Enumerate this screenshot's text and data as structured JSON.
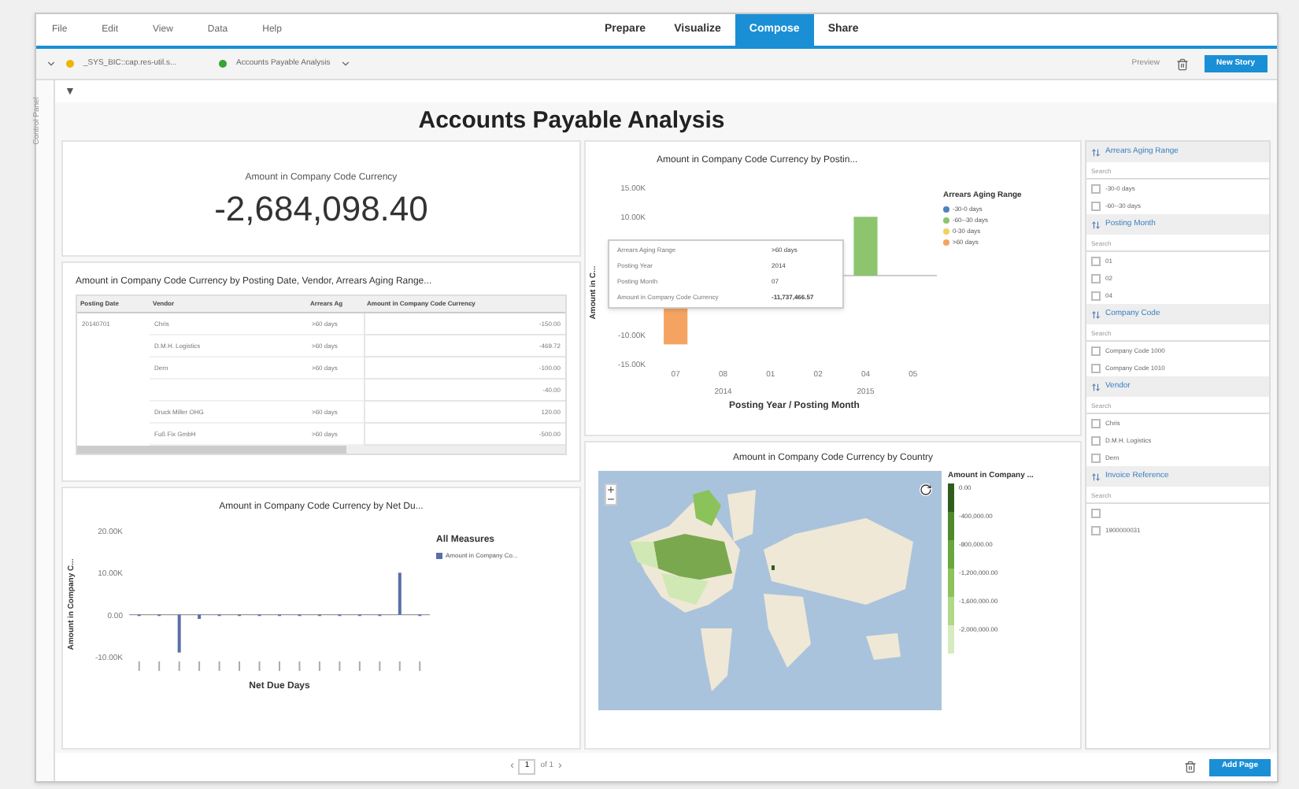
{
  "menu": [
    "File",
    "Edit",
    "View",
    "Data",
    "Help"
  ],
  "mode_tabs": [
    {
      "label": "Prepare",
      "selected": false
    },
    {
      "label": "Visualize",
      "selected": false
    },
    {
      "label": "Compose",
      "selected": true
    },
    {
      "label": "Share",
      "selected": false
    }
  ],
  "toolbar": {
    "source": "_SYS_BIC::cap.res-util.s...",
    "story": "Accounts Payable Analysis",
    "preview": "Preview",
    "new_story": "New Story"
  },
  "control_panel": {
    "label": "Control Panel",
    "filter_toggle": "▼"
  },
  "page_title": "Accounts Payable Analysis",
  "kpi": {
    "title": "Amount in Company Code Currency",
    "value": "-2,684,098.40"
  },
  "table": {
    "title": "Amount in Company Code Currency by Posting Date, Vendor, Arrears Aging Range...",
    "columns": [
      "Posting Date",
      "Vendor",
      "Arrears Ag",
      "Amount in Company Code Currency"
    ],
    "rows": [
      [
        "20140701",
        "Chris",
        ">60 days",
        "-150.00"
      ],
      [
        "",
        "D.M.H. Logistics",
        ">60 days",
        "-469.72"
      ],
      [
        "",
        "Dern",
        ">60 days",
        "-100.00"
      ],
      [
        "",
        "",
        "",
        "-40.00"
      ],
      [
        "",
        "Druck Miller OHG",
        ">60 days",
        "120.00"
      ],
      [
        "",
        "Fuß Fix GmbH",
        ">60 days",
        "-500.00"
      ]
    ]
  },
  "posting_chart": {
    "chart_data": {
      "type": "bar",
      "title": "Amount in Company Code Currency by Postin...",
      "xlabel": "Posting Year / Posting Month",
      "ylabel": "Amount in C...",
      "categories": [
        "07",
        "08",
        "01",
        "02",
        "04",
        "05"
      ],
      "series": [
        {
          "name": "-30-0 days",
          "color": "#4f81bd",
          "values": [
            null,
            null,
            null,
            null,
            null,
            null
          ]
        },
        {
          "name": "-60--30 days",
          "color": "#8cc56d",
          "values": [
            null,
            null,
            null,
            null,
            10000,
            null
          ]
        },
        {
          "name": "0-30 days",
          "color": "#f2d25c",
          "values": [
            null,
            null,
            null,
            null,
            null,
            null
          ]
        },
        {
          "name": ">60 days",
          "color": "#f4a460",
          "values": [
            -11700,
            null,
            null,
            null,
            null,
            null
          ]
        }
      ],
      "ylim": [
        -15000,
        15000
      ],
      "yticks": [
        {
          "value": 15000,
          "label": "15.00K"
        },
        {
          "value": 10000,
          "label": "10.00K"
        },
        {
          "value": -10000,
          "label": "-10.00K"
        },
        {
          "value": -15000,
          "label": "-15.00K"
        }
      ]
    },
    "year_groups": [
      "2014",
      "2015"
    ],
    "legend_title": "Arrears Aging Range",
    "tooltip": [
      {
        "label": "Arrears Aging Range",
        "value": ">60 days"
      },
      {
        "label": "Posting Year",
        "value": "2014"
      },
      {
        "label": "Posting Month",
        "value": "07"
      },
      {
        "label": "Amount in Company Code Currency",
        "value": "-11,737,466.57"
      }
    ]
  },
  "net_due_chart": {
    "chart_data": {
      "type": "bar",
      "title": "Amount in Company Code Currency by Net Du...",
      "xlabel": "Net Due Days",
      "ylabel": "Amount in Company C...",
      "series": [
        {
          "name": "Amount in Company Co...",
          "color": "#5b6fa8",
          "values": [
            -300,
            -300,
            -9000,
            -1000,
            -200,
            -200,
            -300,
            -200,
            -200,
            -200,
            -200,
            -200,
            -200,
            10000,
            0
          ]
        }
      ],
      "ylim": [
        -10000,
        20000
      ],
      "yticks": [
        {
          "value": 20000,
          "label": "20.00K"
        },
        {
          "value": 10000,
          "label": "10.00K"
        },
        {
          "value": 0,
          "label": "0.00"
        },
        {
          "value": -10000,
          "label": "-10.00K"
        }
      ]
    },
    "legend_title": "All Measures"
  },
  "map": {
    "title": "Amount in Company Code Currency by Country",
    "legend_title": "Amount in Company ...",
    "legend": [
      {
        "label": "0.00",
        "color": "#2f5d1e"
      },
      {
        "label": "-400,000.00",
        "color": "#4d8a2e"
      },
      {
        "label": "-800,000.00",
        "color": "#6aa63e"
      },
      {
        "label": "-1,200,000.00",
        "color": "#8cc25a"
      },
      {
        "label": "-1,600,000.00",
        "color": "#b0d889"
      },
      {
        "label": "-2,000,000.00",
        "color": "#d6ecc0"
      }
    ]
  },
  "filters": [
    {
      "title": "Arrears Aging Range",
      "placeholder": "Search",
      "items": [
        {
          "label": "-30-0 days",
          "checked": false
        },
        {
          "label": "-60--30 days",
          "checked": false
        }
      ]
    },
    {
      "title": "Posting Month",
      "placeholder": "Search",
      "items": [
        {
          "label": "01",
          "checked": false
        },
        {
          "label": "02",
          "checked": false
        },
        {
          "label": "04",
          "checked": false
        }
      ]
    },
    {
      "title": "Company Code",
      "placeholder": "Search",
      "items": [
        {
          "label": "Company Code 1000",
          "checked": false
        },
        {
          "label": "Company Code 1010",
          "checked": false
        }
      ]
    },
    {
      "title": "Vendor",
      "placeholder": "Search",
      "items": [
        {
          "label": "Chris",
          "checked": false
        },
        {
          "label": "D.M.H. Logistics",
          "checked": false
        },
        {
          "label": "Dern",
          "checked": false
        }
      ]
    },
    {
      "title": "Invoice Reference",
      "placeholder": "Search",
      "items": [
        {
          "checked": false
        },
        {
          "label": "1900000031",
          "checked": false
        }
      ]
    }
  ],
  "pager": {
    "prev": "‹",
    "page": "1",
    "of": "of 1",
    "next": "›"
  },
  "add_page": "Add Page"
}
